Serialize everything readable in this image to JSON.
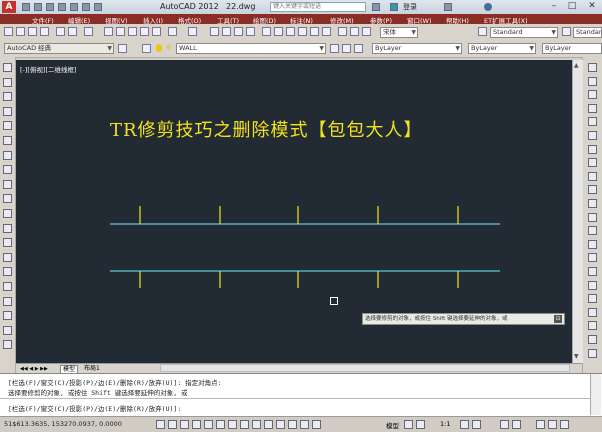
{
  "titlebar": {
    "app_title": "AutoCAD 2012",
    "file_title": "22.dwg",
    "search_placeholder": "键入关键字或短语",
    "login_label": "登录",
    "logo_letter": "A"
  },
  "menu": {
    "items": [
      "文件(F)",
      "编辑(E)",
      "视图(V)",
      "插入(I)",
      "格式(O)",
      "工具(T)",
      "绘图(D)",
      "标注(N)",
      "修改(M)",
      "参数(P)",
      "窗口(W)",
      "帮助(H)",
      "ET扩展工具(X)"
    ]
  },
  "toolbar1": {
    "text_style": "Standard",
    "font": "宋体",
    "dim_style": "Standard"
  },
  "toolbar2": {
    "workspace": "AutoCAD 经典",
    "layer": "WALL",
    "color": "ByLayer",
    "linetype": "ByLayer",
    "lineweight": "ByLayer"
  },
  "canvas": {
    "viewport_label": "[-][俯视][二维线框]",
    "drawing_title": "TR修剪技巧之删除模式【包包大人】",
    "line_color": "#5ec8d8",
    "tick_color": "#f4e21b",
    "tooltip_text": "选择要修剪的对象，或按住 Shift 键选择要延伸的对象，或",
    "tooltip_icon": "⊡"
  },
  "tabs": {
    "model": "模型",
    "layout": "布局1"
  },
  "command": {
    "lines": [
      "[栏选(F)/窗交(C)/投影(P)/边(E)/删除(R)/放弃(U)]:  指定对角点:",
      "选择要修剪的对象, 或按住 Shift 键选择要延伸的对象, 或",
      "[栏选(F)/窗交(C)/投影(P)/边(E)/删除(R)/放弃(U)]:"
    ]
  },
  "status": {
    "coordinates": "51$613.3635,  153270.0937,  0.0000",
    "model_label": "模型",
    "scale": "1:1"
  }
}
